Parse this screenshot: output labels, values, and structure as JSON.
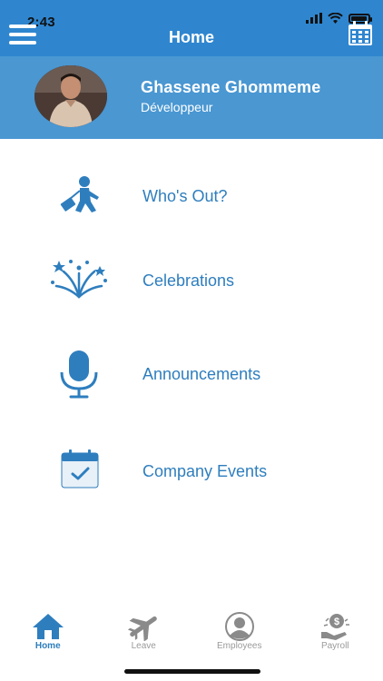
{
  "status_bar": {
    "time": "2:43"
  },
  "header": {
    "title": "Home"
  },
  "profile": {
    "name": "Ghassene Ghommeme",
    "role": "Développeur"
  },
  "menu": [
    {
      "label": "Who's Out?",
      "icon": "traveler-icon"
    },
    {
      "label": "Celebrations",
      "icon": "fireworks-icon"
    },
    {
      "label": "Announcements",
      "icon": "microphone-icon"
    },
    {
      "label": "Company Events",
      "icon": "calendar-check-icon"
    }
  ],
  "tabs": [
    {
      "label": "Home",
      "icon": "home-icon",
      "active": true
    },
    {
      "label": "Leave",
      "icon": "airplane-icon",
      "active": false
    },
    {
      "label": "Employees",
      "icon": "user-icon",
      "active": false
    },
    {
      "label": "Payroll",
      "icon": "payroll-icon",
      "active": false
    }
  ],
  "colors": {
    "header": "#2f86cf",
    "profile": "#4a97d2",
    "accent": "#2e7ebe",
    "inactive": "#9a9a9a"
  }
}
